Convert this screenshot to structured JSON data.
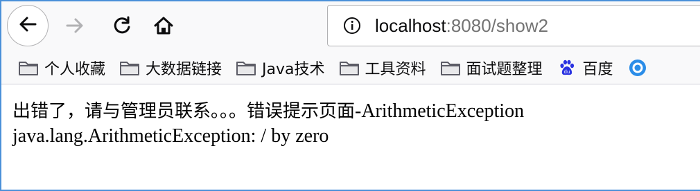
{
  "toolbar": {
    "back_icon": "arrow-left-icon",
    "forward_icon": "arrow-right-icon",
    "reload_icon": "reload-icon",
    "home_icon": "home-icon"
  },
  "urlbar": {
    "host": "localhost",
    "rest": ":8080/show2",
    "icon": "info-icon"
  },
  "bookmarks": [
    {
      "label": "个人收藏",
      "icon": "folder-icon"
    },
    {
      "label": "大数据链接",
      "icon": "folder-icon"
    },
    {
      "label": "Java技术",
      "icon": "folder-icon"
    },
    {
      "label": "工具资料",
      "icon": "folder-icon"
    },
    {
      "label": "面试题整理",
      "icon": "folder-icon"
    },
    {
      "label": "百度",
      "icon": "baidu-paw-icon"
    }
  ],
  "page": {
    "error_prefix": "出错了，请与管理员联系。。。错误提示页面",
    "error_suffix": "-ArithmeticException",
    "exception_message": "java.lang.ArithmeticException: / by zero"
  },
  "colors": {
    "frame_border": "#4a90d9",
    "toolbar_bg": "#f9f9fa",
    "baidu_blue": "#2932e1",
    "folder_gray": "#5c5c66"
  }
}
